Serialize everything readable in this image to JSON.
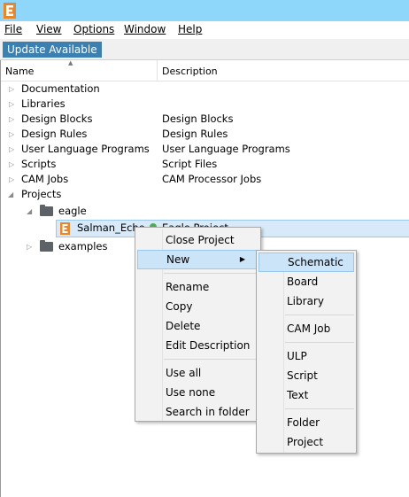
{
  "colors": {
    "titlebar": "#8fd6fb",
    "accent": "#3c7fb1",
    "logo": "#e8862c",
    "selection": "#d8eaf9"
  },
  "app": {
    "logo_letter": "E"
  },
  "menubar": {
    "items": [
      "File",
      "View",
      "Options",
      "Window",
      "Help"
    ]
  },
  "update_button": "Update Available",
  "tree": {
    "columns": {
      "name": "Name",
      "description": "Description"
    },
    "rows": [
      {
        "name": "Documentation",
        "desc": ""
      },
      {
        "name": "Libraries",
        "desc": ""
      },
      {
        "name": "Design Blocks",
        "desc": "Design Blocks"
      },
      {
        "name": "Design Rules",
        "desc": "Design Rules"
      },
      {
        "name": "User Language Programs",
        "desc": "User Language Programs"
      },
      {
        "name": "Scripts",
        "desc": "Script Files"
      },
      {
        "name": "CAM Jobs",
        "desc": "CAM Processor Jobs"
      },
      {
        "name": "Projects",
        "desc": ""
      }
    ],
    "eagle": "eagle",
    "project_name": "Salman_Echo",
    "project_desc": "Eagle Project",
    "examples": "examples"
  },
  "context_menu": {
    "items": [
      "Close Project",
      "New",
      "Rename",
      "Copy",
      "Delete",
      "Edit Description",
      "Use all",
      "Use none",
      "Search in folder"
    ]
  },
  "submenu": {
    "items": [
      "Schematic",
      "Board",
      "Library",
      "CAM Job",
      "ULP",
      "Script",
      "Text",
      "Folder",
      "Project"
    ]
  }
}
